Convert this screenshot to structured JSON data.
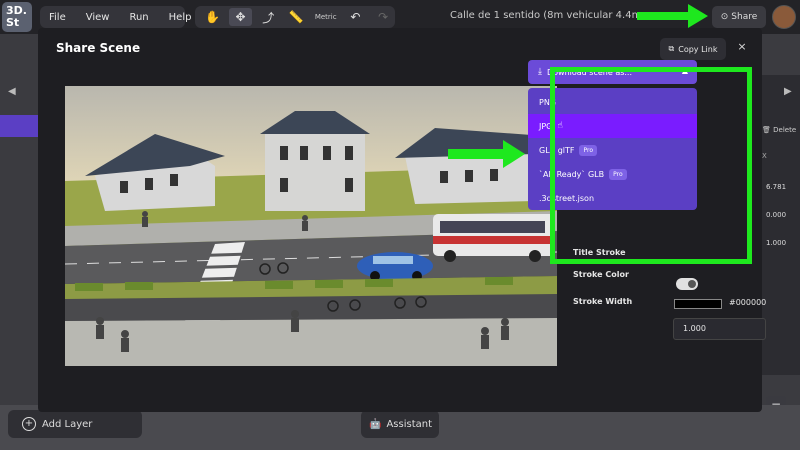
{
  "app": {
    "logo_text": "3D.\nSt",
    "menu": [
      "File",
      "View",
      "Run",
      "Help"
    ],
    "tools": {
      "metric_label": "Metric"
    },
    "scene_title": "Calle de 1 sentido (8m vehicular 4.4m peatonal)",
    "share_label": "Share",
    "right_panel": {
      "delete_label": "Delete",
      "x_label": "X",
      "values": [
        "6.781",
        "0.000",
        "1.000"
      ]
    },
    "add_layer_label": "Add Layer",
    "assistant_label": "Assistant"
  },
  "modal": {
    "title": "Share Scene",
    "copy_link_label": "Copy Link",
    "close_label": "×",
    "download": {
      "button_label": "Download scene as...",
      "options": [
        {
          "label": "PNG",
          "pro": false
        },
        {
          "label": "JPG",
          "pro": false,
          "selected": true
        },
        {
          "label": "GLB glTF",
          "pro": true
        },
        {
          "label": "`AR Ready` GLB",
          "pro": true
        },
        {
          "label": ".3dstreet.json",
          "pro": false
        }
      ],
      "pro_badge": "Pro"
    },
    "title_stroke": {
      "label": "Title Stroke",
      "enabled": true
    },
    "stroke_color": {
      "label": "Stroke Color",
      "value": "#000000"
    },
    "stroke_width": {
      "label": "Stroke Width",
      "value": "1.000"
    }
  },
  "colors": {
    "accent": "#6b4bd8",
    "menu_bg": "#5b3fc4",
    "selected": "#7a1cff",
    "highlight_green": "#1ee81e"
  }
}
